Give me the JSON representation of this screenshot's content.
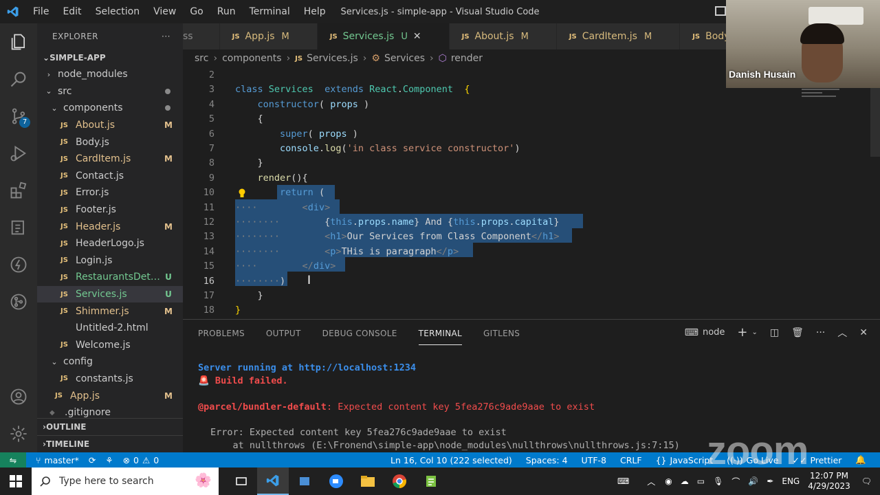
{
  "window": {
    "title": "Services.js - simple-app - Visual Studio Code",
    "menu": [
      "File",
      "Edit",
      "Selection",
      "View",
      "Go",
      "Run",
      "Terminal",
      "Help"
    ]
  },
  "activity": {
    "scm_badge": "7"
  },
  "sidebar": {
    "header": "EXPLORER",
    "more": "···",
    "project": "SIMPLE-APP",
    "tree": [
      {
        "label": "node_modules",
        "kind": "folder",
        "indent": 1,
        "open": false,
        "status": ""
      },
      {
        "label": "src",
        "kind": "folder",
        "indent": 1,
        "open": true,
        "status": "dot"
      },
      {
        "label": "components",
        "kind": "folder",
        "indent": 2,
        "open": true,
        "status": "dot"
      },
      {
        "label": "About.js",
        "kind": "js",
        "indent": 3,
        "status": "M"
      },
      {
        "label": "Body.js",
        "kind": "js",
        "indent": 3,
        "status": ""
      },
      {
        "label": "CardItem.js",
        "kind": "js",
        "indent": 3,
        "status": "M"
      },
      {
        "label": "Contact.js",
        "kind": "js",
        "indent": 3,
        "status": ""
      },
      {
        "label": "Error.js",
        "kind": "js",
        "indent": 3,
        "status": ""
      },
      {
        "label": "Footer.js",
        "kind": "js",
        "indent": 3,
        "status": ""
      },
      {
        "label": "Header.js",
        "kind": "js",
        "indent": 3,
        "status": "M"
      },
      {
        "label": "HeaderLogo.js",
        "kind": "js",
        "indent": 3,
        "status": ""
      },
      {
        "label": "Login.js",
        "kind": "js",
        "indent": 3,
        "status": ""
      },
      {
        "label": "RestaurantsDetai...",
        "kind": "js",
        "indent": 3,
        "status": "U"
      },
      {
        "label": "Services.js",
        "kind": "js",
        "indent": 3,
        "status": "U",
        "selected": true
      },
      {
        "label": "Shimmer.js",
        "kind": "js",
        "indent": 3,
        "status": "M"
      },
      {
        "label": "Untitled-2.html",
        "kind": "html",
        "indent": 3,
        "status": ""
      },
      {
        "label": "Welcome.js",
        "kind": "js",
        "indent": 3,
        "status": ""
      },
      {
        "label": "config",
        "kind": "folder",
        "indent": 2,
        "open": true,
        "status": ""
      },
      {
        "label": "constants.js",
        "kind": "js",
        "indent": 3,
        "status": ""
      },
      {
        "label": "App.js",
        "kind": "js",
        "indent": 2,
        "status": "M"
      },
      {
        "label": ".gitignore",
        "kind": "git",
        "indent": 1,
        "status": ""
      }
    ],
    "outline": "OUTLINE",
    "timeline": "TIMELINE"
  },
  "tabs": [
    {
      "label": "ss",
      "status": "",
      "partial": true
    },
    {
      "label": "App.js",
      "status": "M"
    },
    {
      "label": "Services.js",
      "status": "U",
      "active": true
    },
    {
      "label": "About.js",
      "status": "M"
    },
    {
      "label": "CardItem.js",
      "status": "M"
    },
    {
      "label": "Body.js",
      "status": ""
    }
  ],
  "breadcrumb": {
    "a": "src",
    "b": "components",
    "c": "Services.js",
    "d": "Services",
    "e": "render"
  },
  "code": [
    {
      "n": "2",
      "html": ""
    },
    {
      "n": "3",
      "html": "<span class='k'>class</span> <span class='c'>Services</span>  <span class='k'>extends</span> <span class='c'>React</span><span class='w'>.</span><span class='c'>Component</span>  <span class='y'>{</span>"
    },
    {
      "n": "4",
      "html": "    <span class='k'>constructor</span><span class='w'>( </span><span class='p'>props</span><span class='w'> )</span>"
    },
    {
      "n": "5",
      "html": "    <span class='w'>{</span>"
    },
    {
      "n": "6",
      "html": "        <span class='k'>super</span><span class='w'>( </span><span class='p'>props</span><span class='w'> )</span>"
    },
    {
      "n": "7",
      "html": "        <span class='p'>console</span><span class='w'>.</span><span class='f'>log</span><span class='w'>(</span><span class='s'>'in class service constructor'</span><span class='w'>)</span>"
    },
    {
      "n": "8",
      "html": "    <span class='w'>}</span>"
    },
    {
      "n": "9",
      "html": "    <span class='f'>render</span><span class='w'>(){</span>"
    },
    {
      "n": "10",
      "html": "        <span class='k'>return</span> <span class='w'>(</span>"
    },
    {
      "n": "11",
      "html": "<span class='t'>····</span>        <span class='t'>&lt;</span><span class='tag'>div</span><span class='t'>&gt;</span>"
    },
    {
      "n": "12",
      "html": "<span class='t'>········</span>        <span class='w'>{</span><span class='k'>this</span><span class='w'>.</span><span class='p'>props</span><span class='w'>.</span><span class='p'>name</span><span class='w'>} And {</span><span class='k'>this</span><span class='w'>.</span><span class='p'>props</span><span class='w'>.</span><span class='p'>capital</span><span class='w'>}</span>"
    },
    {
      "n": "13",
      "html": "<span class='t'>········</span>        <span class='t'>&lt;</span><span class='tag'>h1</span><span class='t'>&gt;</span><span class='w'>Our Services from Class Component</span><span class='t'>&lt;/</span><span class='tag'>h1</span><span class='t'>&gt;</span>"
    },
    {
      "n": "14",
      "html": "<span class='t'>········</span>        <span class='t'>&lt;</span><span class='tag'>p</span><span class='t'>&gt;</span><span class='w'>THis is paragraph</span><span class='t'>&lt;/</span><span class='tag'>p</span><span class='t'>&gt;</span>"
    },
    {
      "n": "15",
      "html": "<span class='t'>····</span>        <span class='t'>&lt;/</span><span class='tag'>div</span><span class='t'>&gt;</span>"
    },
    {
      "n": "16",
      "html": "<span class='t'>········</span><span class='w'>)</span>"
    },
    {
      "n": "17",
      "html": "    <span class='w'>}</span>"
    },
    {
      "n": "18",
      "html": "<span class='y'>}</span>"
    }
  ],
  "panel": {
    "tabs": [
      "PROBLEMS",
      "OUTPUT",
      "DEBUG CONSOLE",
      "TERMINAL",
      "GITLENS"
    ],
    "active_tab": "TERMINAL",
    "shell": "node",
    "terminal": {
      "line1_prefix": "Server running at ",
      "line1_url": "http://localhost:1234",
      "line2": "🚨 Build failed.",
      "line3_src": "@parcel/bundler-default",
      "line3_msg": ": Expected content key 5fea276c9ade9aae to exist",
      "line4": "Error: Expected content key 5fea276c9ade9aae to exist",
      "line5": "    at nullthrows (E:\\Fronend\\simple-app\\node_modules\\nullthrows\\nullthrows.js:7:15)"
    }
  },
  "status": {
    "branch": "master*",
    "errors": "0",
    "warnings": "0",
    "position": "Ln 16, Col 10 (222 selected)",
    "spaces": "Spaces: 4",
    "encoding": "UTF-8",
    "eol": "CRLF",
    "language": "JavaScript",
    "golive": "Go Live",
    "prettier": "Prettier"
  },
  "taskbar": {
    "search_placeholder": "Type here to search",
    "lang": "ENG",
    "time": "12:07 PM",
    "date": "4/29/2023"
  },
  "webcam": {
    "name": "Danish Husain"
  },
  "watermark": "zoom"
}
